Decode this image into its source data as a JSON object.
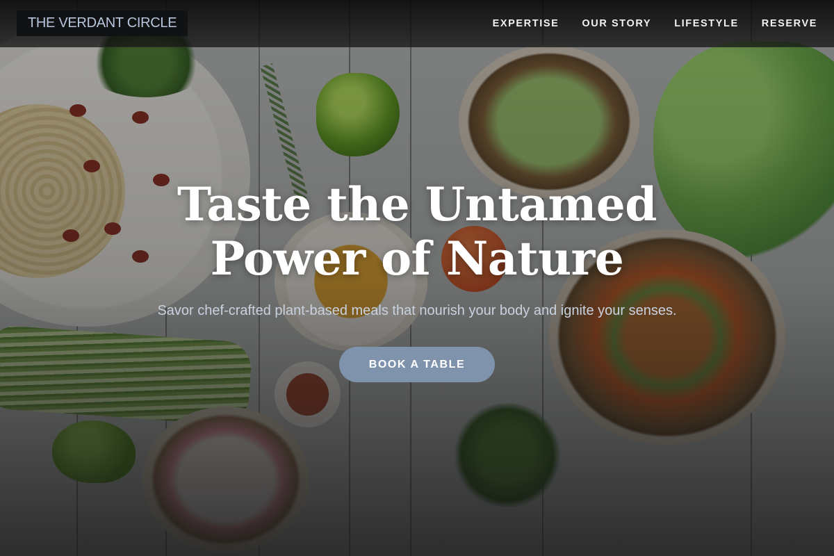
{
  "brand": {
    "name": "THE VERDANT CIRCLE"
  },
  "nav": {
    "items": [
      {
        "label": "EXPERTISE"
      },
      {
        "label": "OUR STORY"
      },
      {
        "label": "LIFESTYLE"
      },
      {
        "label": "RESERVE"
      }
    ]
  },
  "hero": {
    "headline": "Taste the Untamed Power of Nature",
    "subheadline": "Savor chef-crafted plant-based meals that nourish your body and ignite your senses.",
    "cta_label": "BOOK A TABLE",
    "background_description_icon": "food-flatlay-image"
  },
  "colors": {
    "brand_text": "#b7c6dc",
    "cta_background": "#7f93ad",
    "nav_text": "#f2f2f2",
    "subheadline_text": "#c9d2df"
  }
}
